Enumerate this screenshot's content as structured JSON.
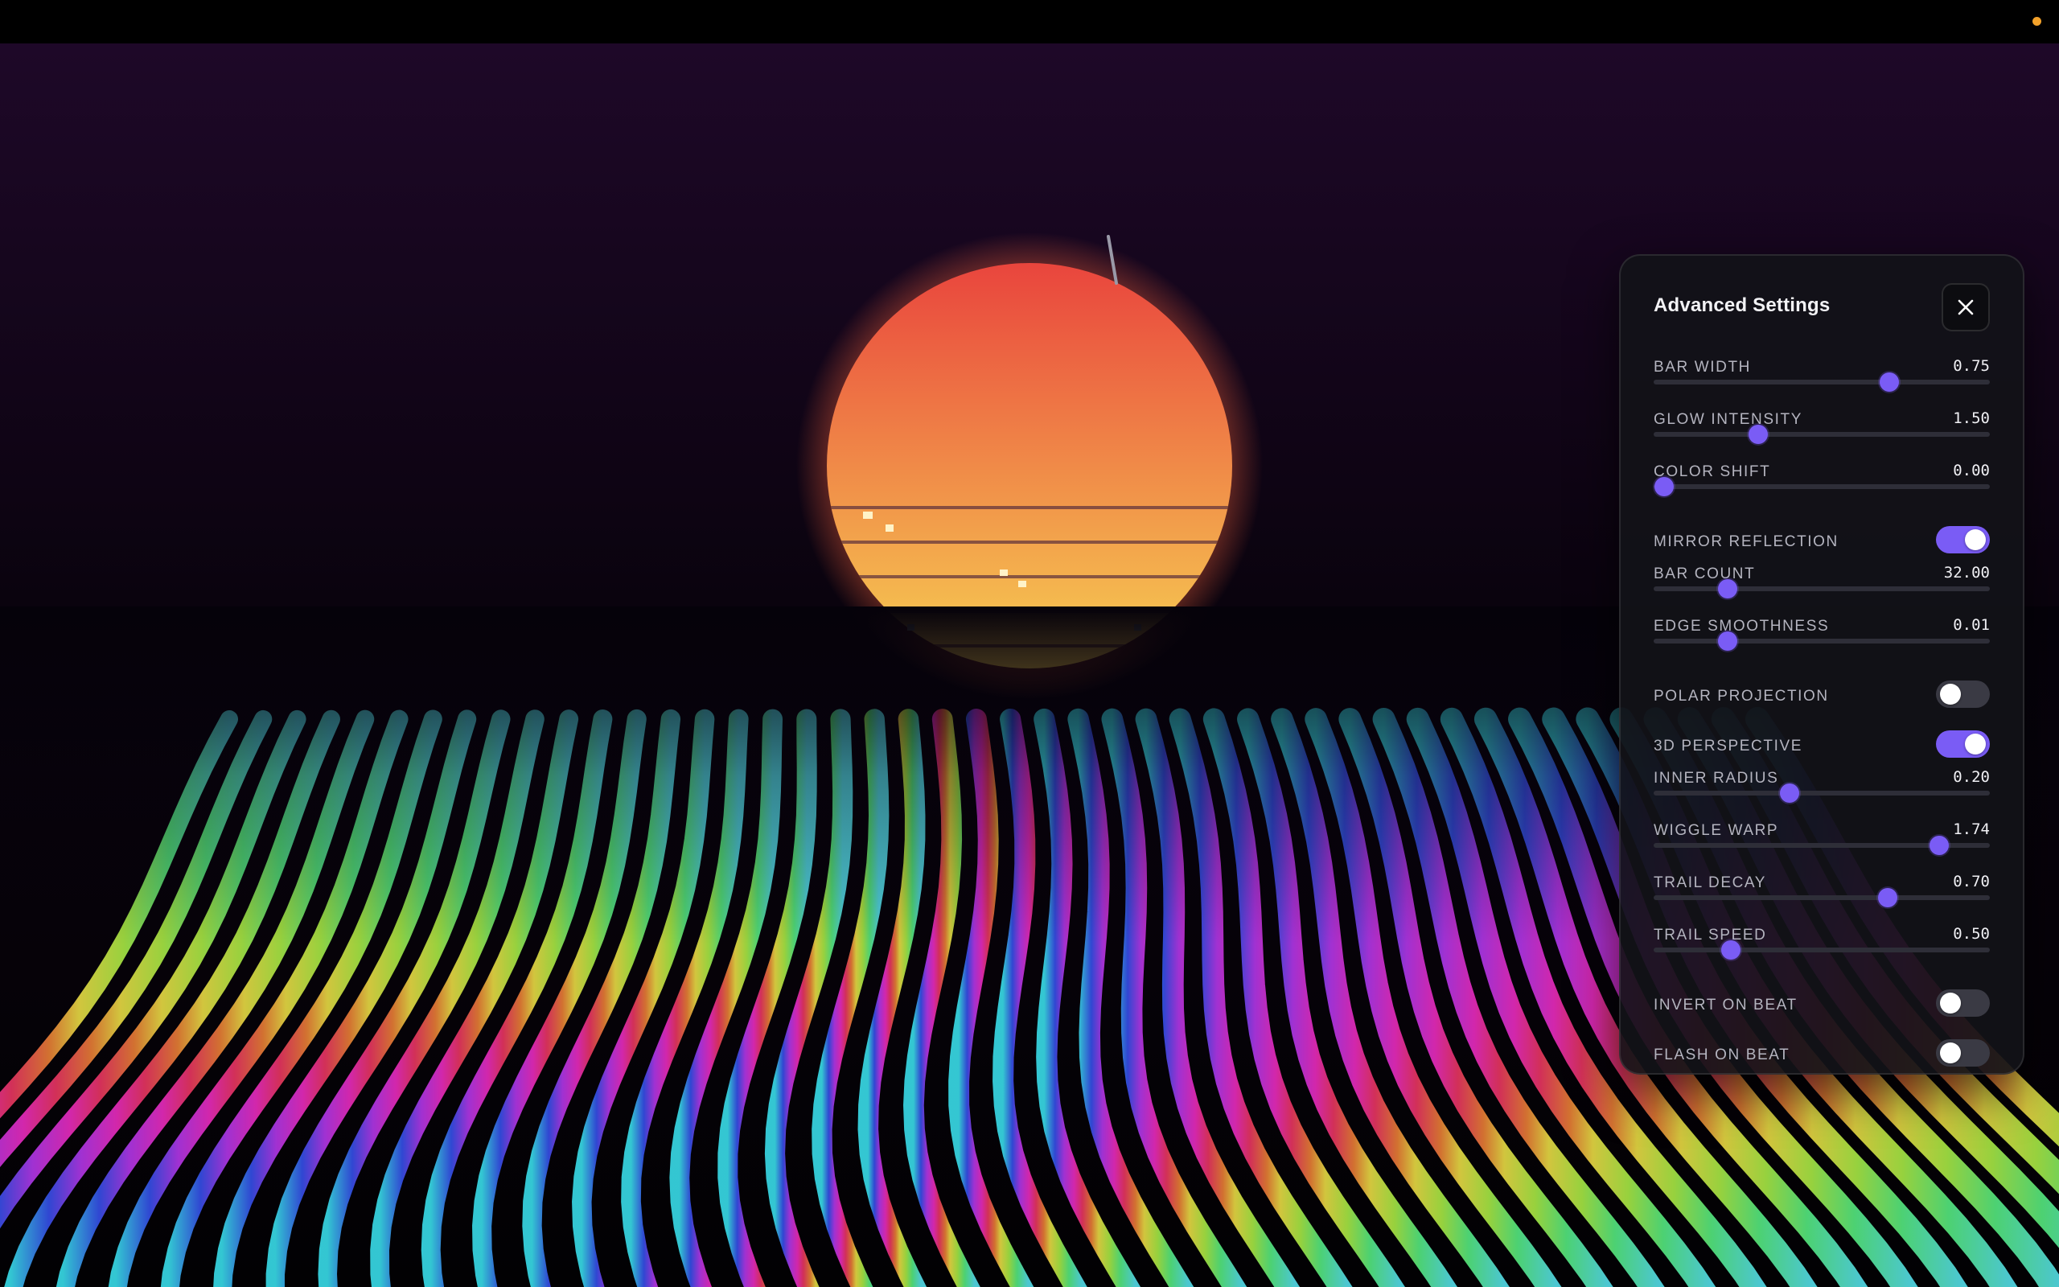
{
  "colors": {
    "accent": "#7a5cf5",
    "panel_bg": "#121218",
    "recording_dot": "#f2a12a",
    "sun_top": "#e9453d",
    "sun_bottom": "#f7cf52"
  },
  "icons": {
    "close": "close-icon"
  },
  "panel": {
    "title": "Advanced Settings",
    "controls": [
      {
        "type": "slider",
        "id": "bar-width",
        "label": "BAR WIDTH",
        "value": "0.75",
        "fraction": 0.7
      },
      {
        "type": "slider",
        "id": "glow-intensity",
        "label": "GLOW INTENSITY",
        "value": "1.50",
        "fraction": 0.31
      },
      {
        "type": "slider",
        "id": "color-shift",
        "label": "COLOR SHIFT",
        "value": "0.00",
        "fraction": 0.03
      },
      {
        "type": "toggle",
        "id": "mirror-reflection",
        "label": "MIRROR REFLECTION",
        "on": true
      },
      {
        "type": "slider",
        "id": "bar-count",
        "label": "BAR COUNT",
        "value": "32.00",
        "fraction": 0.22
      },
      {
        "type": "slider",
        "id": "edge-smoothness",
        "label": "EDGE SMOOTHNESS",
        "value": "0.01",
        "fraction": 0.22
      },
      {
        "type": "toggle",
        "id": "polar-projection",
        "label": "POLAR PROJECTION",
        "on": false
      },
      {
        "type": "toggle",
        "id": "3d-perspective",
        "label": "3D PERSPECTIVE",
        "on": true
      },
      {
        "type": "slider",
        "id": "inner-radius",
        "label": "INNER RADIUS",
        "value": "0.20",
        "fraction": 0.405
      },
      {
        "type": "slider",
        "id": "wiggle-warp",
        "label": "WIGGLE WARP",
        "value": "1.74",
        "fraction": 0.85
      },
      {
        "type": "slider",
        "id": "trail-decay",
        "label": "TRAIL DECAY",
        "value": "0.70",
        "fraction": 0.695
      },
      {
        "type": "slider",
        "id": "trail-speed",
        "label": "TRAIL SPEED",
        "value": "0.50",
        "fraction": 0.23
      },
      {
        "type": "toggle",
        "id": "invert-on-beat",
        "label": "INVERT ON BEAT",
        "on": false
      },
      {
        "type": "toggle",
        "id": "flash-on-beat",
        "label": "FLASH ON BEAT",
        "on": false
      }
    ]
  }
}
